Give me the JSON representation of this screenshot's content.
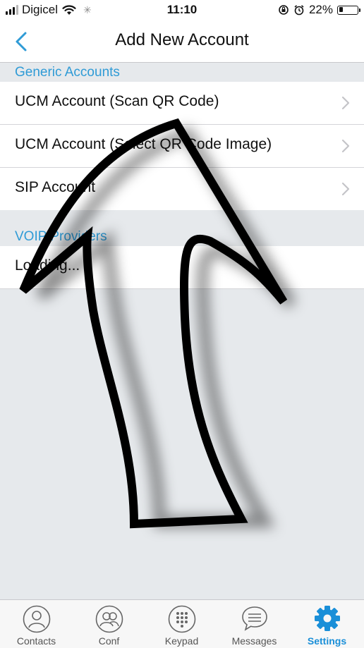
{
  "status_bar": {
    "carrier": "Digicel",
    "time": "11:10",
    "battery_percent": "22%",
    "battery_level": 0.22,
    "icons": [
      "signal-icon",
      "wifi-icon",
      "loading-spinner-icon",
      "orientation-lock-icon",
      "alarm-icon",
      "battery-icon"
    ]
  },
  "nav": {
    "title": "Add New Account",
    "back_icon": "chevron-left-icon"
  },
  "sections": {
    "generic": {
      "header": "Generic Accounts",
      "items": [
        {
          "label": "UCM Account (Scan QR Code)"
        },
        {
          "label": "UCM Account (Select QR Code Image)"
        },
        {
          "label": "SIP Account"
        }
      ]
    },
    "voip": {
      "header": "VOIP Providers",
      "items": [
        {
          "label": "Loading..."
        }
      ]
    }
  },
  "tab_bar": {
    "tabs": [
      {
        "label": "Contacts",
        "icon": "contact-icon"
      },
      {
        "label": "Conf",
        "icon": "conference-icon"
      },
      {
        "label": "Keypad",
        "icon": "keypad-icon"
      },
      {
        "label": "Messages",
        "icon": "message-icon"
      },
      {
        "label": "Settings",
        "icon": "gear-icon"
      }
    ],
    "active": "Settings"
  },
  "colors": {
    "accent": "#2f9bd6",
    "active_tab": "#1a8fd8",
    "background": "#e6e9ec",
    "annotation_arrow": "#000000"
  },
  "annotation": {
    "type": "arrow",
    "direction": "up",
    "points_to": "UCM Account (Scan QR Code)"
  }
}
